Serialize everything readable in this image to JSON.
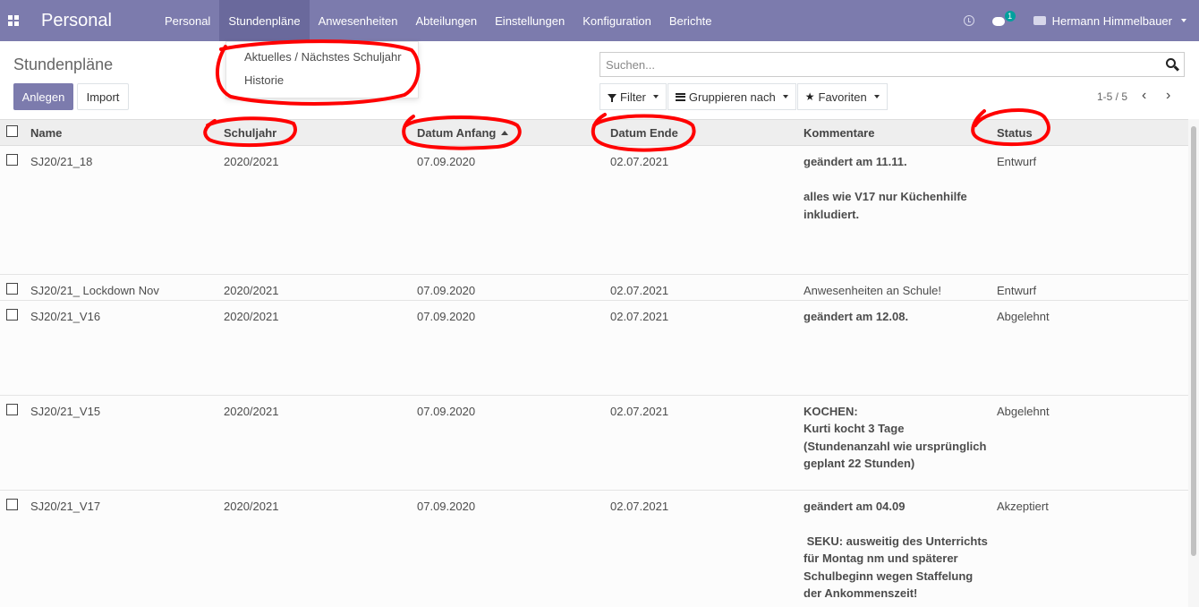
{
  "navbar": {
    "brand": "Personal",
    "menu": [
      "Personal",
      "Stundenpläne",
      "Anwesenheiten",
      "Abteilungen",
      "Einstellungen",
      "Konfiguration",
      "Berichte"
    ],
    "active_index": 1,
    "messages_count": "1",
    "user_name": "Hermann Himmelbauer"
  },
  "dropdown": {
    "items": [
      "Aktuelles / Nächstes Schuljahr",
      "Historie"
    ]
  },
  "control_panel": {
    "breadcrumb": "Stundenpläne",
    "create_label": "Anlegen",
    "import_label": "Import",
    "search_placeholder": "Suchen...",
    "filter_label": "Filter",
    "group_label": "Gruppieren nach",
    "favorites_label": "Favoriten",
    "pager": "1-5 / 5"
  },
  "table": {
    "columns": [
      "Name",
      "Schuljahr",
      "Datum Anfang",
      "Datum Ende",
      "Kommentare",
      "Status"
    ],
    "rows": [
      {
        "name": "SJ20/21_18",
        "schuljahr": "2020/2021",
        "datum_anfang": "07.09.2020",
        "datum_ende": "02.07.2021",
        "kommentar_lines": [
          "geändert am 11.11.",
          "",
          "alles wie V17 nur Küchenhilfe",
          "inkludiert."
        ],
        "kommentar_bold": true,
        "status": "Entwurf"
      },
      {
        "name": "SJ20/21_ Lockdown Nov",
        "schuljahr": "2020/2021",
        "datum_anfang": "07.09.2020",
        "datum_ende": "02.07.2021",
        "kommentar_lines": [
          "Anwesenheiten an Schule!"
        ],
        "kommentar_bold": false,
        "status": "Entwurf"
      },
      {
        "name": "SJ20/21_V16",
        "schuljahr": "2020/2021",
        "datum_anfang": "07.09.2020",
        "datum_ende": "02.07.2021",
        "kommentar_lines": [
          "geändert am 12.08."
        ],
        "kommentar_bold": true,
        "status": "Abgelehnt"
      },
      {
        "name": "SJ20/21_V15",
        "schuljahr": "2020/2021",
        "datum_anfang": "07.09.2020",
        "datum_ende": "02.07.2021",
        "kommentar_lines": [
          "KOCHEN:",
          "Kurti kocht 3 Tage",
          "(Stundenanzahl wie ursprünglich",
          "geplant 22 Stunden)"
        ],
        "kommentar_bold": true,
        "status": "Abgelehnt"
      },
      {
        "name": "SJ20/21_V17",
        "schuljahr": "2020/2021",
        "datum_anfang": "07.09.2020",
        "datum_ende": "02.07.2021",
        "kommentar_lines": [
          "geändert am 04.09",
          "",
          " SEKU: ausweitig des Unterrichts",
          "für Montag nm und späterer",
          "Schulbeginn wegen Staffelung",
          "der Ankommenszeit!"
        ],
        "kommentar_bold": true,
        "status": "Akzeptiert"
      }
    ]
  },
  "colors": {
    "navbar": "#7c7bad",
    "navbar_active": "#6a699c",
    "badge": "#00a09d",
    "annotation": "#ff0000"
  }
}
